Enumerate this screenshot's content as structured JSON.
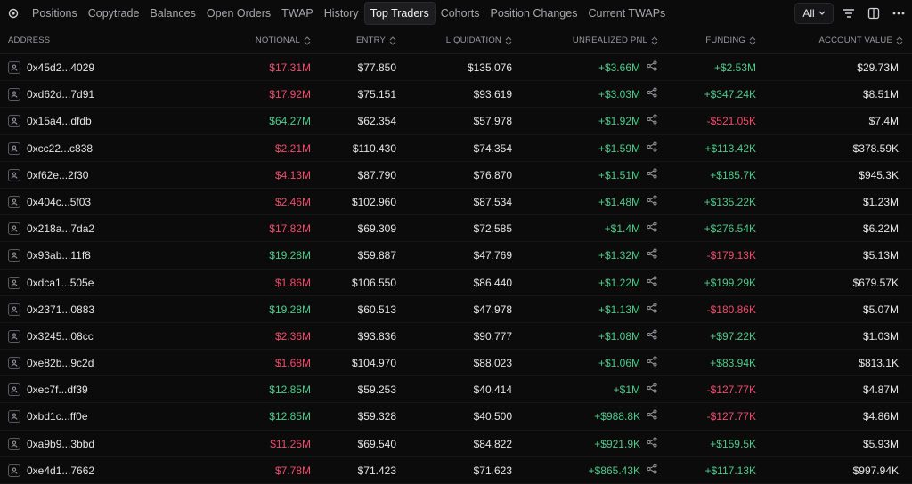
{
  "tabs": [
    {
      "label": "Positions"
    },
    {
      "label": "Copytrade"
    },
    {
      "label": "Balances"
    },
    {
      "label": "Open Orders"
    },
    {
      "label": "TWAP"
    },
    {
      "label": "History"
    },
    {
      "label": "Top Traders",
      "active": true
    },
    {
      "label": "Cohorts"
    },
    {
      "label": "Position Changes"
    },
    {
      "label": "Current TWAPs"
    }
  ],
  "filter": {
    "value": "All"
  },
  "columns": {
    "address": "ADDRESS",
    "notional": "NOTIONAL",
    "entry": "ENTRY",
    "liquidation": "LIQUIDATION",
    "unrealized_pnl": "UNREALIZED PNL",
    "funding": "FUNDING",
    "account_value": "ACCOUNT VALUE"
  },
  "colors": {
    "positive": "#4ecb8a",
    "negative": "#ef4d6b",
    "neutral": "#e6e6e6"
  },
  "rows": [
    {
      "address": "0x45d2...4029",
      "notional": "$17.31M",
      "notional_sign": "neg",
      "entry": "$77.850",
      "liquidation": "$135.076",
      "pnl": "+$3.66M",
      "funding": "+$2.53M",
      "funding_sign": "pos",
      "account_value": "$29.73M"
    },
    {
      "address": "0xd62d...7d91",
      "notional": "$17.92M",
      "notional_sign": "neg",
      "entry": "$75.151",
      "liquidation": "$93.619",
      "pnl": "+$3.03M",
      "funding": "+$347.24K",
      "funding_sign": "pos",
      "account_value": "$8.51M"
    },
    {
      "address": "0x15a4...dfdb",
      "notional": "$64.27M",
      "notional_sign": "pos",
      "entry": "$62.354",
      "liquidation": "$57.978",
      "pnl": "+$1.92M",
      "funding": "-$521.05K",
      "funding_sign": "neg",
      "account_value": "$7.4M"
    },
    {
      "address": "0xcc22...c838",
      "notional": "$2.21M",
      "notional_sign": "neg",
      "entry": "$110.430",
      "liquidation": "$74.354",
      "pnl": "+$1.59M",
      "funding": "+$113.42K",
      "funding_sign": "pos",
      "account_value": "$378.59K"
    },
    {
      "address": "0xf62e...2f30",
      "notional": "$4.13M",
      "notional_sign": "neg",
      "entry": "$87.790",
      "liquidation": "$76.870",
      "pnl": "+$1.51M",
      "funding": "+$185.7K",
      "funding_sign": "pos",
      "account_value": "$945.3K"
    },
    {
      "address": "0x404c...5f03",
      "notional": "$2.46M",
      "notional_sign": "neg",
      "entry": "$102.960",
      "liquidation": "$87.534",
      "pnl": "+$1.48M",
      "funding": "+$135.22K",
      "funding_sign": "pos",
      "account_value": "$1.23M"
    },
    {
      "address": "0x218a...7da2",
      "notional": "$17.82M",
      "notional_sign": "neg",
      "entry": "$69.309",
      "liquidation": "$72.585",
      "pnl": "+$1.4M",
      "funding": "+$276.54K",
      "funding_sign": "pos",
      "account_value": "$6.22M"
    },
    {
      "address": "0x93ab...11f8",
      "notional": "$19.28M",
      "notional_sign": "pos",
      "entry": "$59.887",
      "liquidation": "$47.769",
      "pnl": "+$1.32M",
      "funding": "-$179.13K",
      "funding_sign": "neg",
      "account_value": "$5.13M"
    },
    {
      "address": "0xdca1...505e",
      "notional": "$1.86M",
      "notional_sign": "neg",
      "entry": "$106.550",
      "liquidation": "$86.440",
      "pnl": "+$1.22M",
      "funding": "+$199.29K",
      "funding_sign": "pos",
      "account_value": "$679.57K"
    },
    {
      "address": "0x2371...0883",
      "notional": "$19.28M",
      "notional_sign": "pos",
      "entry": "$60.513",
      "liquidation": "$47.978",
      "pnl": "+$1.13M",
      "funding": "-$180.86K",
      "funding_sign": "neg",
      "account_value": "$5.07M"
    },
    {
      "address": "0x3245...08cc",
      "notional": "$2.36M",
      "notional_sign": "neg",
      "entry": "$93.836",
      "liquidation": "$90.777",
      "pnl": "+$1.08M",
      "funding": "+$97.22K",
      "funding_sign": "pos",
      "account_value": "$1.03M"
    },
    {
      "address": "0xe82b...9c2d",
      "notional": "$1.68M",
      "notional_sign": "neg",
      "entry": "$104.970",
      "liquidation": "$88.023",
      "pnl": "+$1.06M",
      "funding": "+$83.94K",
      "funding_sign": "pos",
      "account_value": "$813.1K"
    },
    {
      "address": "0xec7f...df39",
      "notional": "$12.85M",
      "notional_sign": "pos",
      "entry": "$59.253",
      "liquidation": "$40.414",
      "pnl": "+$1M",
      "funding": "-$127.77K",
      "funding_sign": "neg",
      "account_value": "$4.87M"
    },
    {
      "address": "0xbd1c...ff0e",
      "notional": "$12.85M",
      "notional_sign": "pos",
      "entry": "$59.328",
      "liquidation": "$40.500",
      "pnl": "+$988.8K",
      "funding": "-$127.77K",
      "funding_sign": "neg",
      "account_value": "$4.86M"
    },
    {
      "address": "0xa9b9...3bbd",
      "notional": "$11.25M",
      "notional_sign": "neg",
      "entry": "$69.540",
      "liquidation": "$84.822",
      "pnl": "+$921.9K",
      "funding": "+$159.5K",
      "funding_sign": "pos",
      "account_value": "$5.93M"
    },
    {
      "address": "0xe4d1...7662",
      "notional": "$7.78M",
      "notional_sign": "neg",
      "entry": "$71.423",
      "liquidation": "$71.623",
      "pnl": "+$865.43K",
      "funding": "+$117.13K",
      "funding_sign": "pos",
      "account_value": "$997.94K"
    }
  ]
}
